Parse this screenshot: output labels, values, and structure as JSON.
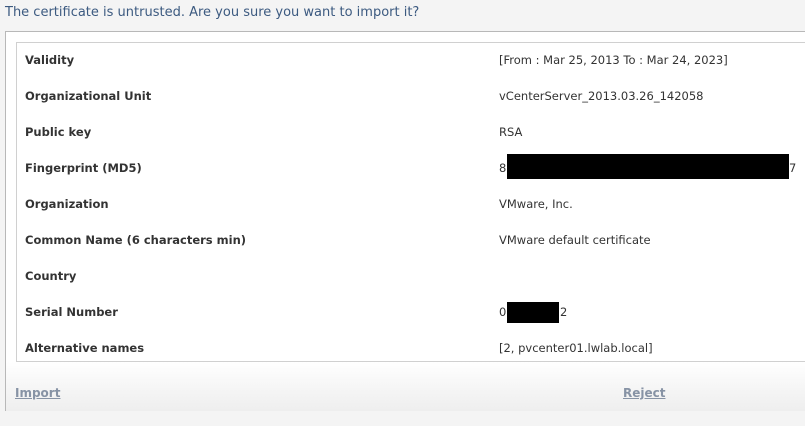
{
  "dialog": {
    "prompt": "The certificate is untrusted. Are you sure you want to import it?"
  },
  "certificate": {
    "fields": [
      {
        "label": "Validity",
        "value": "[From : Mar 25, 2013 To : Mar 24, 2023]"
      },
      {
        "label": "Organizational Unit",
        "value": "vCenterServer_2013.03.26_142058"
      },
      {
        "label": "Public key",
        "value": "RSA"
      },
      {
        "label": "Fingerprint (MD5)",
        "value_prefix": "8",
        "value_suffix": "7"
      },
      {
        "label": "Organization",
        "value": "VMware, Inc."
      },
      {
        "label": "Common Name (6 characters min)",
        "value": "VMware default certificate"
      },
      {
        "label": "Country",
        "value": ""
      },
      {
        "label": "Serial Number",
        "value_prefix": "0",
        "value_suffix": "2"
      },
      {
        "label": "Alternative names",
        "value": "[2, pvcenter01.lwlab.local]"
      }
    ]
  },
  "actions": {
    "import_label": "Import",
    "reject_label": "Reject"
  },
  "colors": {
    "prompt_text": "#3c5a80",
    "link_text": "#8793a5",
    "redaction": "#000000"
  }
}
